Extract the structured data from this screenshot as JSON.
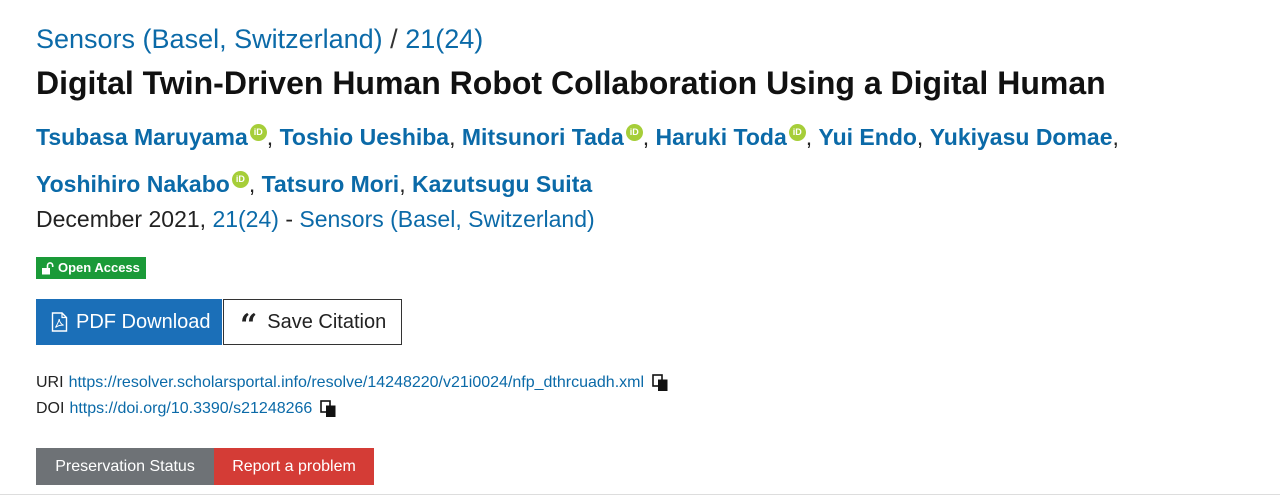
{
  "breadcrumb": {
    "journal": "Sensors (Basel, Switzerland)",
    "separator": "/",
    "issue": "21(24)"
  },
  "article": {
    "title": "Digital Twin-Driven Human Robot Collaboration Using a Digital Human"
  },
  "authors": [
    {
      "name": "Tsubasa Maruyama",
      "orcid": true
    },
    {
      "name": "Toshio Ueshiba",
      "orcid": false
    },
    {
      "name": "Mitsunori Tada",
      "orcid": true
    },
    {
      "name": "Haruki Toda",
      "orcid": true
    },
    {
      "name": "Yui Endo",
      "orcid": false
    },
    {
      "name": "Yukiyasu Domae",
      "orcid": false
    },
    {
      "name": "Yoshihiro Nakabo",
      "orcid": true
    },
    {
      "name": "Tatsuro Mori",
      "orcid": false
    },
    {
      "name": "Kazutsugu Suita",
      "orcid": false
    }
  ],
  "orcid_badge": "iD",
  "publication": {
    "date": "December 2021,",
    "issue": "21(24)",
    "dash": "-",
    "journal": "Sensors (Basel, Switzerland)"
  },
  "access": {
    "label": "Open Access",
    "icon": "unlock-icon",
    "color": "#1a9a38"
  },
  "actions": {
    "pdf_label": "PDF Download",
    "pdf_icon": "pdf-file-icon",
    "cite_label": "Save Citation",
    "cite_icon": "quote-icon"
  },
  "identifiers": {
    "uri_label": "URI",
    "uri": "https://resolver.scholarsportal.info/resolve/14248220/v21i0024/nfp_dthrcuadh.xml",
    "doi_label": "DOI",
    "doi": "https://doi.org/10.3390/s21248266",
    "copy_icon": "copy-icon"
  },
  "footer_buttons": {
    "preservation_label": "Preservation Status",
    "report_label": "Report a problem"
  },
  "colors": {
    "link": "#0b6aa8",
    "primary_button": "#1b6fb8",
    "preservation_button": "#6e7276",
    "report_button": "#d43c36",
    "orcid": "#a6ce39"
  }
}
